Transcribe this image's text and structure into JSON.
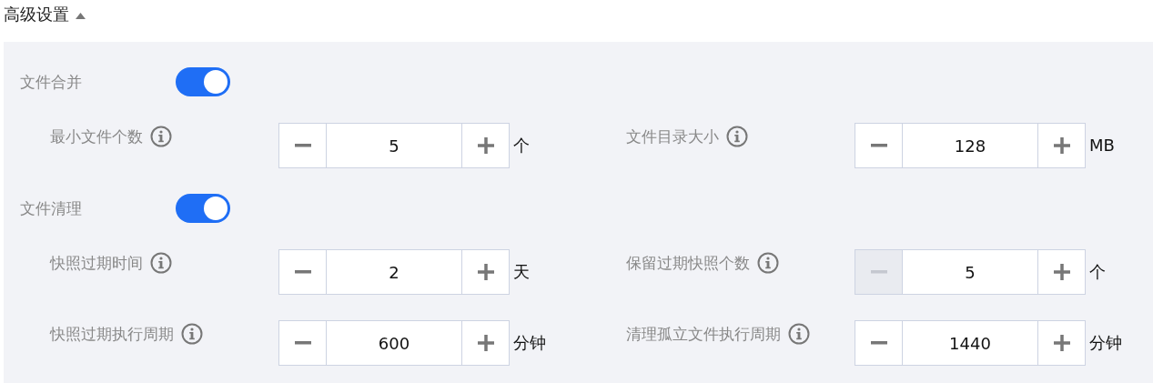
{
  "header": {
    "title": "高级设置",
    "expanded": true
  },
  "sections": [
    {
      "title": "文件合并",
      "on": true,
      "fields": [
        {
          "label": "最小文件个数",
          "value": "5",
          "unit": "个",
          "decrement_disabled": false
        },
        {
          "label": "文件目录大小",
          "value": "128",
          "unit": "MB",
          "decrement_disabled": false
        }
      ]
    },
    {
      "title": "文件清理",
      "on": true,
      "fields": [
        {
          "label": "快照过期时间",
          "value": "2",
          "unit": "天",
          "decrement_disabled": false
        },
        {
          "label": "保留过期快照个数",
          "value": "5",
          "unit": "个",
          "decrement_disabled": true
        },
        {
          "label": "快照过期执行周期",
          "value": "600",
          "unit": "分钟",
          "decrement_disabled": false
        },
        {
          "label": "清理孤立文件执行周期",
          "value": "1440",
          "unit": "分钟",
          "decrement_disabled": false
        }
      ]
    }
  ]
}
